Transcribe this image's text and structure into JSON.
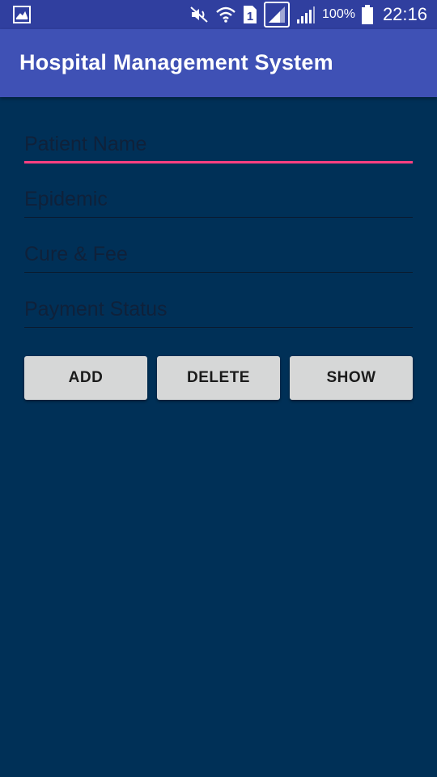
{
  "status_bar": {
    "left_icon": "gallery-icon",
    "icons": [
      "mute-icon",
      "wifi-icon",
      "sim-1-icon",
      "signal-box-icon",
      "signal-icon"
    ],
    "battery_text": "100%",
    "battery_icon": "battery-icon",
    "time": "22:16"
  },
  "app_bar": {
    "title": "Hospital Management System",
    "color": "#3f51b5"
  },
  "form": {
    "fields": [
      {
        "placeholder": "Patient Name",
        "value": ""
      },
      {
        "placeholder": "Epidemic",
        "value": ""
      },
      {
        "placeholder": "Cure & Fee",
        "value": ""
      },
      {
        "placeholder": "Payment Status",
        "value": ""
      }
    ],
    "accent_color": "#ff4081"
  },
  "buttons": {
    "add_label": "ADD",
    "delete_label": "DELETE",
    "show_label": "SHOW"
  },
  "colors": {
    "background": "#003057",
    "status_bar": "#303f9f"
  }
}
